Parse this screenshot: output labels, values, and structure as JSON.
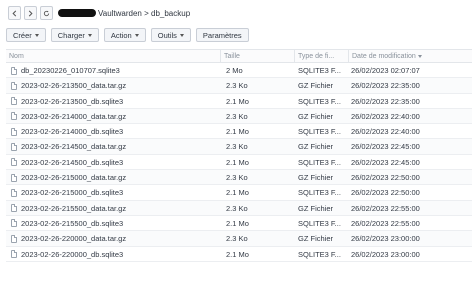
{
  "nav": {
    "path": "Vaultwarden > db_backup"
  },
  "toolbar": {
    "create": "Créer",
    "upload": "Charger",
    "action": "Action",
    "tools": "Outils",
    "settings": "Paramètres"
  },
  "columns": {
    "name": "Nom",
    "size": "Taille",
    "type": "Type de fi...",
    "date": "Date de modification"
  },
  "files": [
    {
      "name": "db_20230226_010707.sqlite3",
      "size": "2 Mo",
      "type": "SQLITE3 F...",
      "date": "26/02/2023 02:07:07"
    },
    {
      "name": "2023-02-26-213500_data.tar.gz",
      "size": "2.3 Ko",
      "type": "GZ Fichier",
      "date": "26/02/2023 22:35:00"
    },
    {
      "name": "2023-02-26-213500_db.sqlite3",
      "size": "2.1 Mo",
      "type": "SQLITE3 F...",
      "date": "26/02/2023 22:35:00"
    },
    {
      "name": "2023-02-26-214000_data.tar.gz",
      "size": "2.3 Ko",
      "type": "GZ Fichier",
      "date": "26/02/2023 22:40:00"
    },
    {
      "name": "2023-02-26-214000_db.sqlite3",
      "size": "2.1 Mo",
      "type": "SQLITE3 F...",
      "date": "26/02/2023 22:40:00"
    },
    {
      "name": "2023-02-26-214500_data.tar.gz",
      "size": "2.3 Ko",
      "type": "GZ Fichier",
      "date": "26/02/2023 22:45:00"
    },
    {
      "name": "2023-02-26-214500_db.sqlite3",
      "size": "2.1 Mo",
      "type": "SQLITE3 F...",
      "date": "26/02/2023 22:45:00"
    },
    {
      "name": "2023-02-26-215000_data.tar.gz",
      "size": "2.3 Ko",
      "type": "GZ Fichier",
      "date": "26/02/2023 22:50:00"
    },
    {
      "name": "2023-02-26-215000_db.sqlite3",
      "size": "2.1 Mo",
      "type": "SQLITE3 F...",
      "date": "26/02/2023 22:50:00"
    },
    {
      "name": "2023-02-26-215500_data.tar.gz",
      "size": "2.3 Ko",
      "type": "GZ Fichier",
      "date": "26/02/2023 22:55:00"
    },
    {
      "name": "2023-02-26-215500_db.sqlite3",
      "size": "2.1 Mo",
      "type": "SQLITE3 F...",
      "date": "26/02/2023 22:55:00"
    },
    {
      "name": "2023-02-26-220000_data.tar.gz",
      "size": "2.3 Ko",
      "type": "GZ Fichier",
      "date": "26/02/2023 23:00:00"
    },
    {
      "name": "2023-02-26-220000_db.sqlite3",
      "size": "2.1 Mo",
      "type": "SQLITE3 F...",
      "date": "26/02/2023 23:00:00"
    }
  ]
}
